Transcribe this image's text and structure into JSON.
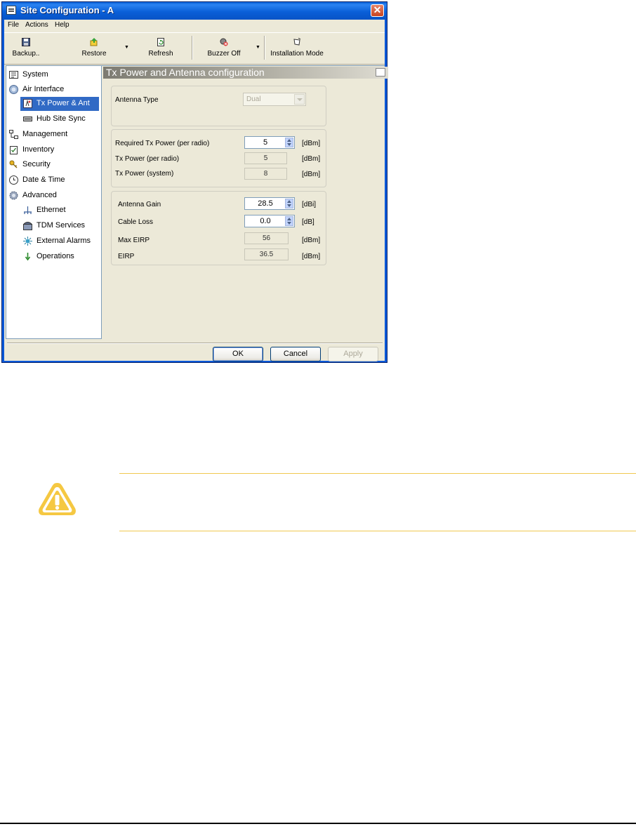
{
  "window": {
    "title": "Site Configuration - A",
    "close_glyph": "✕"
  },
  "menu": [
    "File",
    "Actions",
    "Help"
  ],
  "toolbar": {
    "backup": "Backup..",
    "restore": "Restore",
    "refresh": "Refresh",
    "buzzer_off": "Buzzer Off",
    "installation_mode": "Installation Mode"
  },
  "sidebar": {
    "items": [
      {
        "label": "System",
        "icon": "system-icon"
      },
      {
        "label": "Air Interface",
        "icon": "globe-icon"
      },
      {
        "label": "Tx Power & Ant",
        "icon": "antenna-icon",
        "selected": true
      },
      {
        "label": "Hub Site Sync",
        "icon": "sync-icon"
      },
      {
        "label": "Management",
        "icon": "network-icon"
      },
      {
        "label": "Inventory",
        "icon": "clipboard-icon"
      },
      {
        "label": "Security",
        "icon": "key-icon"
      },
      {
        "label": "Date & Time",
        "icon": "clock-icon"
      },
      {
        "label": "Advanced",
        "icon": "gear-icon"
      },
      {
        "label": "Ethernet",
        "icon": "ethernet-icon"
      },
      {
        "label": "TDM Services",
        "icon": "telephone-icon"
      },
      {
        "label": "External Alarms",
        "icon": "alarm-icon"
      },
      {
        "label": "Operations",
        "icon": "arrow-down-icon"
      }
    ]
  },
  "panel": {
    "title": "Tx Power and Antenna configuration",
    "antenna_type": {
      "label": "Antenna Type",
      "value": "Dual"
    },
    "power": {
      "required": {
        "label": "Required Tx Power (per radio)",
        "value": "5",
        "unit": "[dBm]"
      },
      "per_radio": {
        "label": "Tx Power (per radio)",
        "value": "5",
        "unit": "[dBm]"
      },
      "system": {
        "label": "Tx Power (system)",
        "value": "8",
        "unit": "[dBm]"
      }
    },
    "gain": {
      "antenna_gain": {
        "label": "Antenna Gain",
        "value": "28.5",
        "unit": "[dBi]"
      },
      "cable_loss": {
        "label": "Cable Loss",
        "value": "0.0",
        "unit": "[dB]"
      },
      "max_eirp": {
        "label": "Max EIRP",
        "value": "56",
        "unit": "[dBm]"
      },
      "eirp": {
        "label": "EIRP",
        "value": "36.5",
        "unit": "[dBm]"
      }
    }
  },
  "buttons": {
    "ok": "OK",
    "cancel": "Cancel",
    "apply": "Apply"
  },
  "colors": {
    "selection": "#316ac5",
    "warning_line": "#f0c850",
    "warning_icon": "#f5c842"
  }
}
